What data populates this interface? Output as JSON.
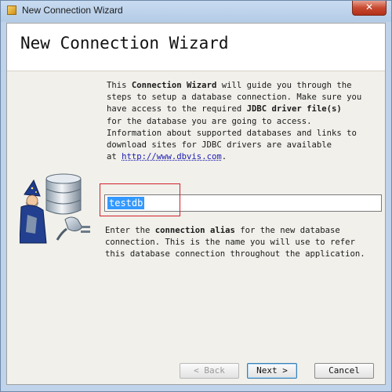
{
  "window": {
    "title": "New Connection Wizard",
    "close_label": "✕"
  },
  "header": {
    "title": "New Connection Wizard"
  },
  "intro": {
    "line1_a": "This ",
    "line1_b": "Connection Wizard",
    "line1_c": " will guide you through the",
    "line2": "steps to setup a database connection. Make sure you",
    "line3_a": "have access to the required ",
    "line3_b": "JDBC driver file(s)",
    "line4": "for the database you are going to access.",
    "line5": "Information about supported databases and links to",
    "line6": "download sites for JDBC drivers are available",
    "line7_a": "at ",
    "link": "http://www.dbvis.com",
    "line7_c": "."
  },
  "alias": {
    "value": "testdb"
  },
  "description": {
    "line1_a": "Enter the ",
    "line1_b": "connection alias",
    "line1_c": " for the new database",
    "line2": "connection. This is the name you will use to refer",
    "line3": "this database connection throughout the application."
  },
  "buttons": {
    "back": "< Back",
    "next": "Next >",
    "cancel": "Cancel"
  },
  "icons": {
    "app": "app-icon",
    "database": "database-wizard-icon"
  }
}
